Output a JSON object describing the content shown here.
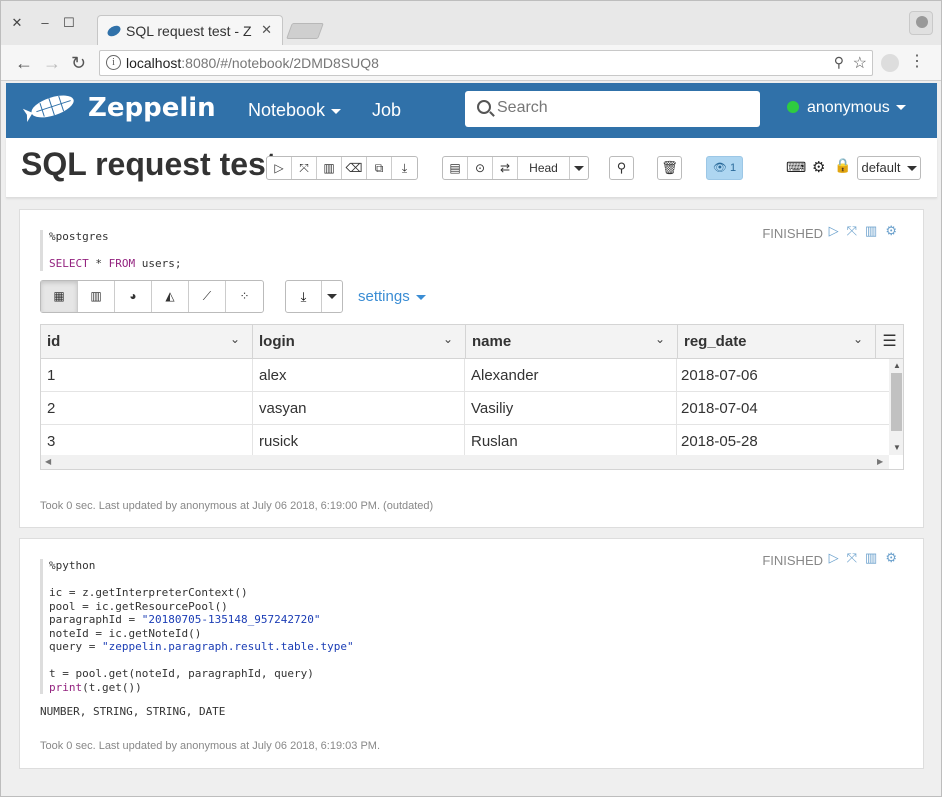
{
  "browser": {
    "tab_title": "SQL request test - Z",
    "url_host": "localhost",
    "url_rest": ":8080/#/notebook/2DMD8SUQ8"
  },
  "navbar": {
    "brand": "Zeppelin",
    "notebook_label": "Notebook",
    "job_label": "Job",
    "search_placeholder": "Search",
    "user": "anonymous",
    "status_color": "#2ecc40"
  },
  "notebook": {
    "title": "SQL request test",
    "head_label": "Head",
    "viewers_count": "1",
    "interpreter_label": "default"
  },
  "paragraph1": {
    "status": "FINISHED",
    "interpreter_line": "%postgres",
    "code_keyword1": "SELECT",
    "code_middle": " * ",
    "code_keyword2": "FROM",
    "code_rest": " users;",
    "settings_label": "settings",
    "columns": [
      "id",
      "login",
      "name",
      "reg_date"
    ],
    "rows": [
      [
        "1",
        "alex",
        "Alexander",
        "2018-07-06"
      ],
      [
        "2",
        "vasyan",
        "Vasiliy",
        "2018-07-04"
      ],
      [
        "3",
        "rusick",
        "Ruslan",
        "2018-05-28"
      ]
    ],
    "footer": "Took 0 sec. Last updated by anonymous at July 06 2018, 6:19:00 PM. (outdated)"
  },
  "paragraph2": {
    "status": "FINISHED",
    "interpreter_line": "%python",
    "line1": "ic = z.getInterpreterContext()",
    "line2": "pool = ic.getResourcePool()",
    "line3_a": "paragraphId = ",
    "line3_b": "\"20180705-135148_957242720\"",
    "line4": "noteId = ic.getNoteId()",
    "line5_a": "query = ",
    "line5_b": "\"zeppelin.paragraph.result.table.type\"",
    "line6": "t = pool.get(noteId, paragraphId, query)",
    "line7_a": "print",
    "line7_b": "(t.get())",
    "output": "NUMBER, STRING, STRING, DATE",
    "footer": "Took 0 sec. Last updated by anonymous at July 06 2018, 6:19:03 PM."
  }
}
